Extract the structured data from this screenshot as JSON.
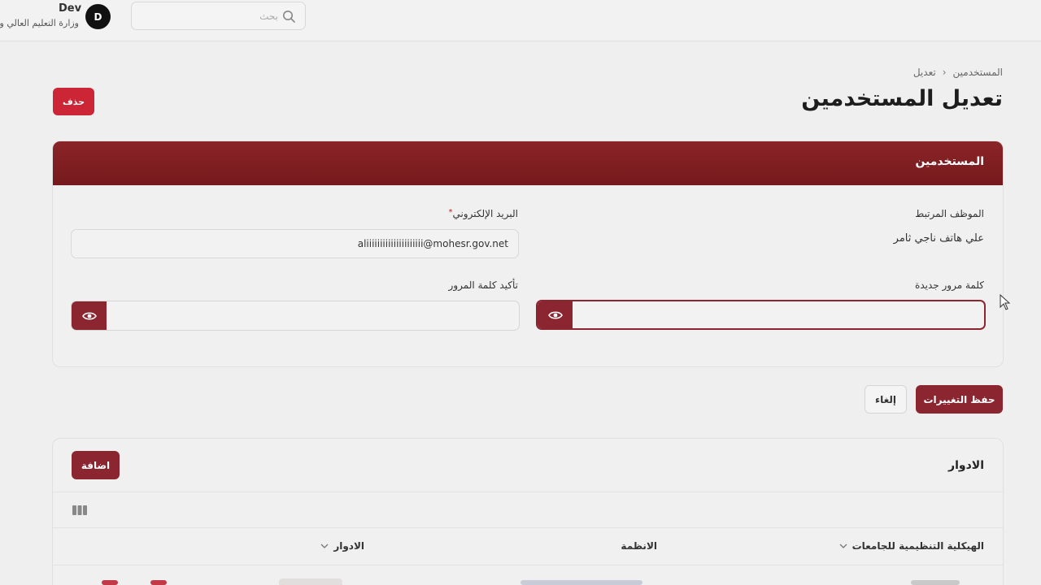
{
  "user": {
    "name": "Dev",
    "organization": "وزارة التعليم العالي والبحث العلمي",
    "avatar_letter": "D"
  },
  "search": {
    "placeholder": "بحث"
  },
  "breadcrumb": {
    "root": "المستخدمين",
    "current": "تعديل"
  },
  "page": {
    "title": "تعديل المستخدمين",
    "delete_label": "حذف"
  },
  "users_card": {
    "title": "المستخدمين",
    "linked_employee_label": "الموظف المرتبط",
    "linked_employee_value": "علي هاتف ناجي ثامر",
    "email_label": "البريد الإلكتروني",
    "email_required_mark": "*",
    "email_value": "aliiiiiiiiiiiiiiiiiiiii@mohesr.gov.net",
    "new_password_label": "كلمة مرور جديدة",
    "confirm_password_label": "تأكيد كلمة المرور"
  },
  "actions": {
    "save_label": "حفظ التغييرات",
    "cancel_label": "إلغاء"
  },
  "roles_card": {
    "title": "الادوار",
    "add_label": "اضافة",
    "columns": [
      "الهيكلية التنظيمية للجامعات",
      "الانظمة",
      "الادوار"
    ]
  },
  "colors": {
    "primary": "#8b2630",
    "danger": "#cc2536",
    "header_gradient": "#8a2428"
  }
}
